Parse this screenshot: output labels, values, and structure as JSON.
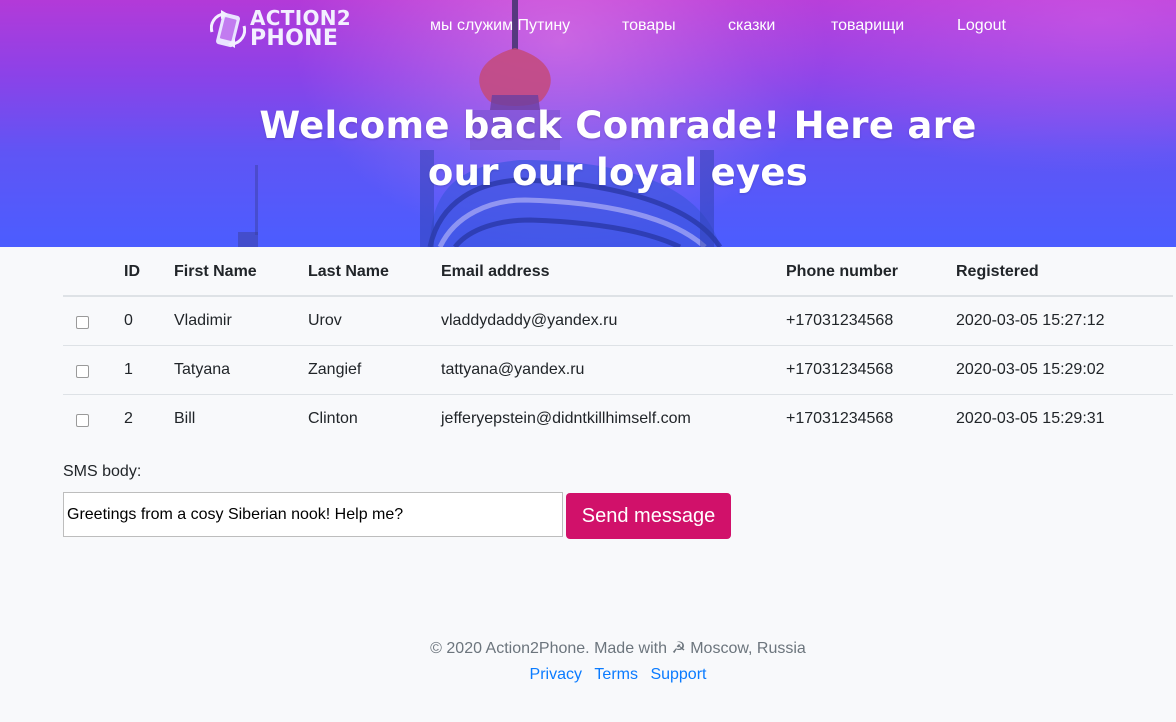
{
  "brand": {
    "line1": "ACTION2",
    "line2": "PHONE"
  },
  "nav": {
    "items": [
      {
        "label": "мы служим Путину"
      },
      {
        "label": "товары"
      },
      {
        "label": "сказки"
      },
      {
        "label": "товарищи"
      },
      {
        "label": "Logout"
      }
    ]
  },
  "hero": {
    "title_line1": "Welcome back Comrade! Here are",
    "title_line2": "our our loyal eyes"
  },
  "table": {
    "headers": {
      "id": "ID",
      "first_name": "First Name",
      "last_name": "Last Name",
      "email": "Email address",
      "phone": "Phone number",
      "registered": "Registered"
    },
    "rows": [
      {
        "id": "0",
        "first_name": "Vladimir",
        "last_name": "Urov",
        "email": "vladdydaddy@yandex.ru",
        "phone": "+17031234568",
        "registered": "2020-03-05 15:27:12",
        "checked": false
      },
      {
        "id": "1",
        "first_name": "Tatyana",
        "last_name": "Zangief",
        "email": "tattyana@yandex.ru",
        "phone": "+17031234568",
        "registered": "2020-03-05 15:29:02",
        "checked": false
      },
      {
        "id": "2",
        "first_name": "Bill",
        "last_name": "Clinton",
        "email": "jefferyepstein@didntkillhimself.com",
        "phone": "+17031234568",
        "registered": "2020-03-05 15:29:31",
        "checked": false
      }
    ]
  },
  "sms": {
    "label": "SMS body:",
    "value": "Greetings from a cosy Siberian nook! Help me?",
    "send_label": "Send message"
  },
  "footer": {
    "copyright": "© 2020 Action2Phone. Made with ☭ Moscow, Russia",
    "links": [
      {
        "label": "Privacy"
      },
      {
        "label": "Terms"
      },
      {
        "label": "Support"
      }
    ]
  },
  "colors": {
    "accent": "#d1116a",
    "link": "#0a7bff",
    "hero_top": "#b33ad8",
    "hero_bottom": "#4b5dff"
  }
}
